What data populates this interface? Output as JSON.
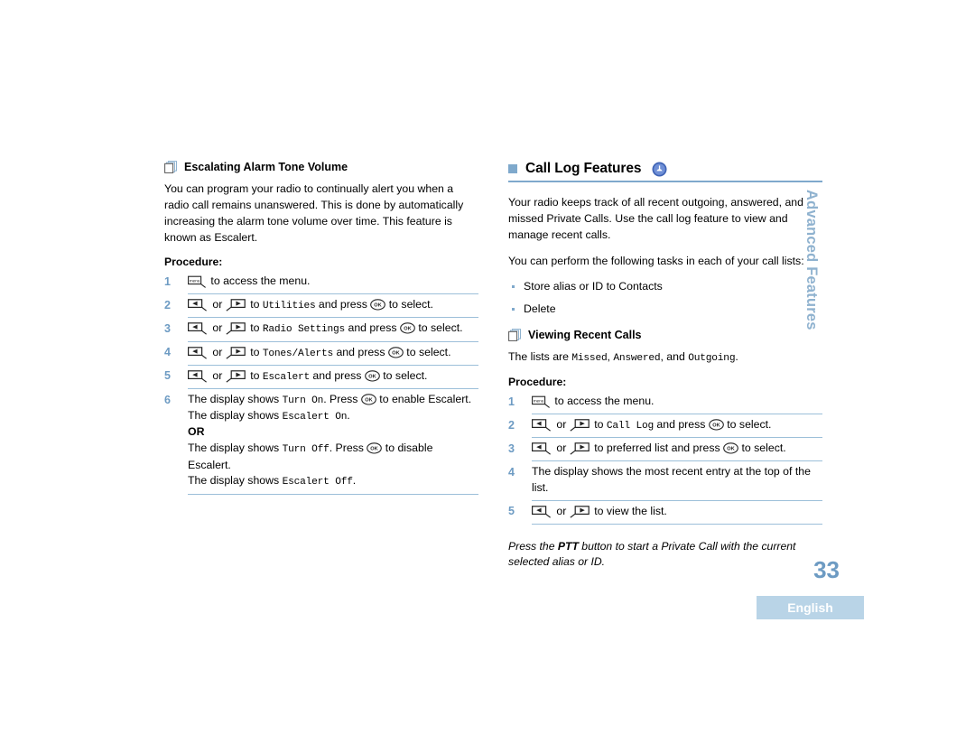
{
  "page": {
    "number": "33",
    "language": "English",
    "side_tab": "Advanced Features"
  },
  "left_column": {
    "heading": "Escalating Alarm Tone Volume",
    "heading_icon": "stacked-pages-icon",
    "intro": "You can program your radio to continually alert you when a radio call remains unanswered. This is done by automatically increasing the alarm tone volume over time. This feature is known as Escalert.",
    "procedure_label": "Procedure:",
    "steps": [
      {
        "num": "1",
        "parts": [
          {
            "type": "icon",
            "name": "menu-key-icon"
          },
          {
            "type": "text",
            "value": " to access the menu."
          }
        ]
      },
      {
        "num": "2",
        "parts": [
          {
            "type": "icon",
            "name": "left-arrow-key-icon"
          },
          {
            "type": "text",
            "value": " or "
          },
          {
            "type": "icon",
            "name": "right-arrow-key-icon"
          },
          {
            "type": "text",
            "value": " to "
          },
          {
            "type": "mono",
            "value": "Utilities"
          },
          {
            "type": "text",
            "value": " and press "
          },
          {
            "type": "icon",
            "name": "ok-key-icon"
          },
          {
            "type": "text",
            "value": " to select."
          }
        ]
      },
      {
        "num": "3",
        "parts": [
          {
            "type": "icon",
            "name": "left-arrow-key-icon"
          },
          {
            "type": "text",
            "value": " or "
          },
          {
            "type": "icon",
            "name": "right-arrow-key-icon"
          },
          {
            "type": "text",
            "value": " to "
          },
          {
            "type": "mono",
            "value": "Radio Settings"
          },
          {
            "type": "text",
            "value": " and press "
          },
          {
            "type": "icon",
            "name": "ok-key-icon"
          },
          {
            "type": "text",
            "value": " to select."
          }
        ]
      },
      {
        "num": "4",
        "parts": [
          {
            "type": "icon",
            "name": "left-arrow-key-icon"
          },
          {
            "type": "text",
            "value": " or "
          },
          {
            "type": "icon",
            "name": "right-arrow-key-icon"
          },
          {
            "type": "text",
            "value": " to "
          },
          {
            "type": "mono",
            "value": "Tones/Alerts"
          },
          {
            "type": "text",
            "value": " and press "
          },
          {
            "type": "icon",
            "name": "ok-key-icon"
          },
          {
            "type": "text",
            "value": " to select."
          }
        ]
      },
      {
        "num": "5",
        "parts": [
          {
            "type": "icon",
            "name": "left-arrow-key-icon"
          },
          {
            "type": "text",
            "value": " or "
          },
          {
            "type": "icon",
            "name": "right-arrow-key-icon"
          },
          {
            "type": "text",
            "value": " to "
          },
          {
            "type": "mono",
            "value": "Escalert"
          },
          {
            "type": "text",
            "value": " and press "
          },
          {
            "type": "icon",
            "name": "ok-key-icon"
          },
          {
            "type": "text",
            "value": " to select."
          }
        ]
      },
      {
        "num": "6",
        "parts": [
          {
            "type": "text",
            "value": "The display shows "
          },
          {
            "type": "mono",
            "value": "Turn On"
          },
          {
            "type": "text",
            "value": ". Press "
          },
          {
            "type": "icon",
            "name": "ok-key-icon"
          },
          {
            "type": "text",
            "value": " to enable Escalert."
          },
          {
            "type": "break"
          },
          {
            "type": "text",
            "value": "The display shows "
          },
          {
            "type": "mono",
            "value": "Escalert On"
          },
          {
            "type": "text",
            "value": "."
          },
          {
            "type": "break"
          },
          {
            "type": "bold",
            "value": "OR"
          },
          {
            "type": "break"
          },
          {
            "type": "text",
            "value": "The display shows "
          },
          {
            "type": "mono",
            "value": "Turn Off"
          },
          {
            "type": "text",
            "value": ". Press "
          },
          {
            "type": "icon",
            "name": "ok-key-icon"
          },
          {
            "type": "text",
            "value": " to disable Escalert."
          },
          {
            "type": "break"
          },
          {
            "type": "text",
            "value": "The display shows "
          },
          {
            "type": "mono",
            "value": "Escalert Off"
          },
          {
            "type": "text",
            "value": "."
          }
        ]
      }
    ]
  },
  "right_column": {
    "heading": "Call Log Features",
    "heading_badge_icon": "call-log-badge-icon",
    "intro_1": "Your radio keeps track of all recent outgoing, answered, and missed Private Calls. Use the call log feature to view and manage recent calls.",
    "intro_2": "You can perform the following tasks in each of your call lists:",
    "tasks": [
      "Store alias or ID to Contacts",
      "Delete"
    ],
    "subheading": "Viewing Recent Calls",
    "subheading_icon": "stacked-pages-icon",
    "lists_line": {
      "parts": [
        {
          "type": "text",
          "value": "The lists are "
        },
        {
          "type": "mono",
          "value": "Missed"
        },
        {
          "type": "text",
          "value": ", "
        },
        {
          "type": "mono",
          "value": "Answered"
        },
        {
          "type": "text",
          "value": ", and "
        },
        {
          "type": "mono",
          "value": "Outgoing"
        },
        {
          "type": "text",
          "value": "."
        }
      ]
    },
    "procedure_label": "Procedure:",
    "steps": [
      {
        "num": "1",
        "parts": [
          {
            "type": "icon",
            "name": "menu-key-icon"
          },
          {
            "type": "text",
            "value": " to access the menu."
          }
        ]
      },
      {
        "num": "2",
        "parts": [
          {
            "type": "icon",
            "name": "left-arrow-key-icon"
          },
          {
            "type": "text",
            "value": " or "
          },
          {
            "type": "icon",
            "name": "right-arrow-key-icon"
          },
          {
            "type": "text",
            "value": " to "
          },
          {
            "type": "mono",
            "value": "Call Log"
          },
          {
            "type": "text",
            "value": " and press "
          },
          {
            "type": "icon",
            "name": "ok-key-icon"
          },
          {
            "type": "text",
            "value": " to select."
          }
        ]
      },
      {
        "num": "3",
        "parts": [
          {
            "type": "icon",
            "name": "left-arrow-key-icon"
          },
          {
            "type": "text",
            "value": " or "
          },
          {
            "type": "icon",
            "name": "right-arrow-key-icon"
          },
          {
            "type": "text",
            "value": " to preferred list and press "
          },
          {
            "type": "icon",
            "name": "ok-key-icon"
          },
          {
            "type": "text",
            "value": " to select."
          }
        ]
      },
      {
        "num": "4",
        "parts": [
          {
            "type": "text",
            "value": "The display shows the most recent entry at the top of the list."
          }
        ]
      },
      {
        "num": "5",
        "parts": [
          {
            "type": "icon",
            "name": "left-arrow-key-icon"
          },
          {
            "type": "text",
            "value": " or "
          },
          {
            "type": "icon",
            "name": "right-arrow-key-icon"
          },
          {
            "type": "text",
            "value": " to view the list."
          }
        ]
      }
    ],
    "note": {
      "parts": [
        {
          "type": "text",
          "value": "Press the "
        },
        {
          "type": "bold",
          "value": "PTT"
        },
        {
          "type": "text",
          "value": " button to start a Private Call with the current selected alias or ID."
        }
      ]
    }
  },
  "colors": {
    "accent_blue": "#7fa9cc",
    "step_number": "#6d9bc3",
    "rule": "#9cbfd9",
    "lang_bar": "#b9d4e7",
    "side_tab": "#8fb2cf"
  }
}
